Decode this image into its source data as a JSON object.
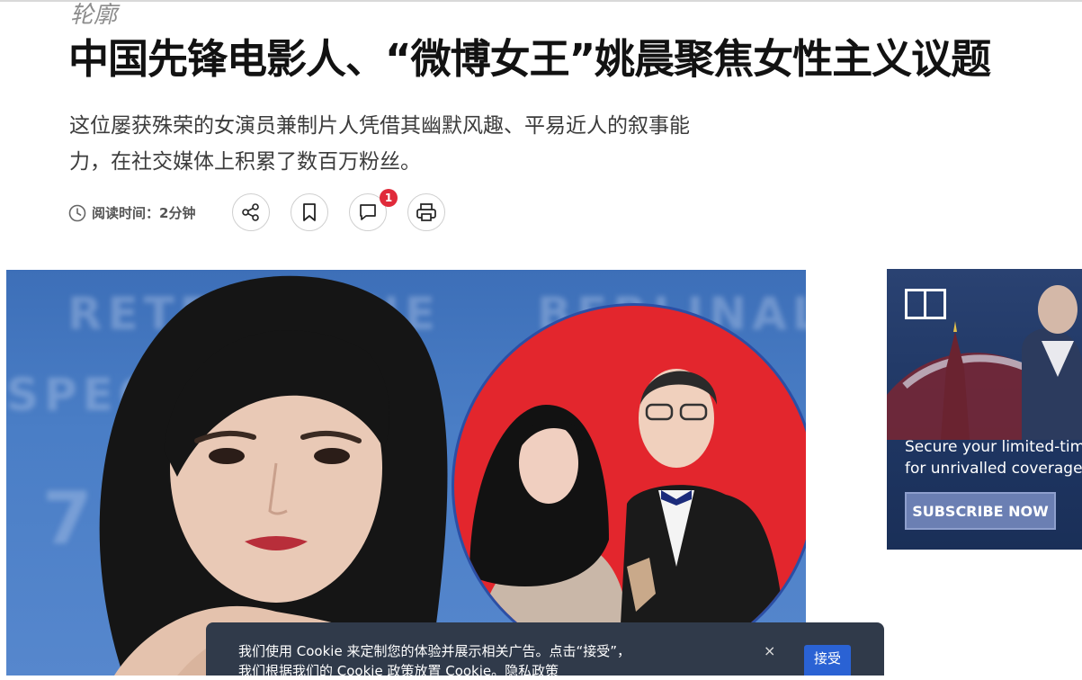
{
  "article": {
    "kicker": "轮廓",
    "headline": "中国先锋电影人、“微博女王”姚晨聚焦女性主义议题",
    "standfirst_line1": "这位屡获殊荣的女演员兼制片人凭借其幽默风趣、平易近人的叙事能",
    "standfirst_line2": "力，在社交媒体上积累了数百万粉丝。"
  },
  "toolbar": {
    "reading_time": "阅读时间：2分钟",
    "comment_count": "1",
    "icons": [
      "clock-icon",
      "share-icon",
      "bookmark-icon",
      "comment-icon",
      "print-icon"
    ]
  },
  "hero_image": {
    "background_text_row1": "BERLINALE",
    "background_text_row2": "SPEC",
    "background_text_row3": "7"
  },
  "ad": {
    "copy_line1": "Secure your limited-tim",
    "copy_line2": "for unrivalled coverage",
    "cta": "SUBSCRIBE NOW"
  },
  "cookie_banner": {
    "line1": "我们使用 Cookie 来定制您的体验并展示相关广告。点击“接受”，",
    "line2": "我们根据我们的 Cookie 政策放置 Cookie。隐私政策",
    "close": "×",
    "accept_label": "接受"
  },
  "colors": {
    "badge": "#e02a3a",
    "cookie_bg": "#303a4a",
    "accept_button": "#2a62d4",
    "hero_bg": "#4a7ec6",
    "inset_circle": "#e3262d"
  }
}
